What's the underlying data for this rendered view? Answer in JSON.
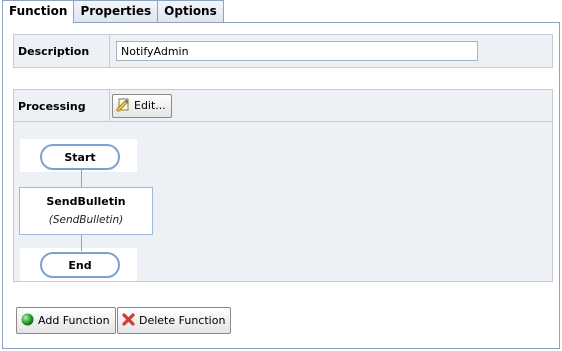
{
  "tabs": [
    {
      "label": "Function",
      "active": true
    },
    {
      "label": "Properties",
      "active": false
    },
    {
      "label": "Options",
      "active": false
    }
  ],
  "description": {
    "label": "Description",
    "value": "NotifyAdmin"
  },
  "processing": {
    "label": "Processing",
    "edit_button": "Edit..."
  },
  "flowchart": {
    "start_label": "Start",
    "steps": [
      {
        "name": "SendBulletin",
        "subtitle": "(SendBulletin)"
      }
    ],
    "end_label": "End"
  },
  "actions": {
    "add_function": "Add Function",
    "delete_function": "Delete Function"
  },
  "icons": {
    "edit": "edit-document-icon",
    "add": "green-circle-icon",
    "delete": "red-x-icon"
  },
  "colors": {
    "tab_border": "#8fa3c0",
    "panel_bg": "#edf0f4",
    "flow_border": "#7ea2cf",
    "add_green": "#2e9e2e",
    "delete_red": "#d83a2a"
  }
}
